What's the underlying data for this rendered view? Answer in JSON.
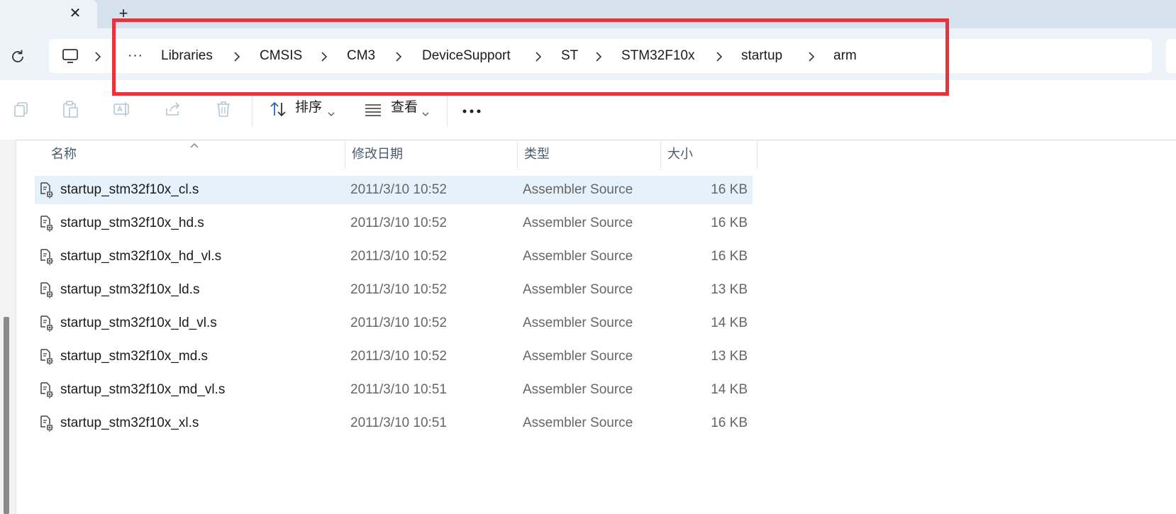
{
  "tabs": {
    "close_glyph": "✕",
    "new_glyph": "+"
  },
  "address": {
    "overflow": "···",
    "crumbs": [
      "Libraries",
      "CMSIS",
      "CM3",
      "DeviceSupport",
      "ST",
      "STM32F10x",
      "startup",
      "arm"
    ]
  },
  "toolbar": {
    "sort_label": "排序",
    "view_label": "查看",
    "icons": [
      "copy-icon",
      "paste-icon",
      "rename-icon",
      "share-icon",
      "delete-icon",
      "sort-icon",
      "view-icon",
      "more-icon"
    ]
  },
  "columns": {
    "name": "名称",
    "date": "修改日期",
    "type": "类型",
    "size": "大小"
  },
  "files": [
    {
      "name": "startup_stm32f10x_cl.s",
      "date": "2011/3/10 10:52",
      "type": "Assembler Source",
      "size": "16 KB",
      "selected": true
    },
    {
      "name": "startup_stm32f10x_hd.s",
      "date": "2011/3/10 10:52",
      "type": "Assembler Source",
      "size": "16 KB"
    },
    {
      "name": "startup_stm32f10x_hd_vl.s",
      "date": "2011/3/10 10:52",
      "type": "Assembler Source",
      "size": "16 KB"
    },
    {
      "name": "startup_stm32f10x_ld.s",
      "date": "2011/3/10 10:52",
      "type": "Assembler Source",
      "size": "13 KB"
    },
    {
      "name": "startup_stm32f10x_ld_vl.s",
      "date": "2011/3/10 10:52",
      "type": "Assembler Source",
      "size": "14 KB"
    },
    {
      "name": "startup_stm32f10x_md.s",
      "date": "2011/3/10 10:52",
      "type": "Assembler Source",
      "size": "13 KB"
    },
    {
      "name": "startup_stm32f10x_md_vl.s",
      "date": "2011/3/10 10:51",
      "type": "Assembler Source",
      "size": "14 KB"
    },
    {
      "name": "startup_stm32f10x_xl.s",
      "date": "2011/3/10 10:51",
      "type": "Assembler Source",
      "size": "16 KB"
    }
  ],
  "colors": {
    "highlight_box": "#e8323c",
    "selected_row": "#e5f1fb",
    "chrome": "#eef3f9"
  }
}
